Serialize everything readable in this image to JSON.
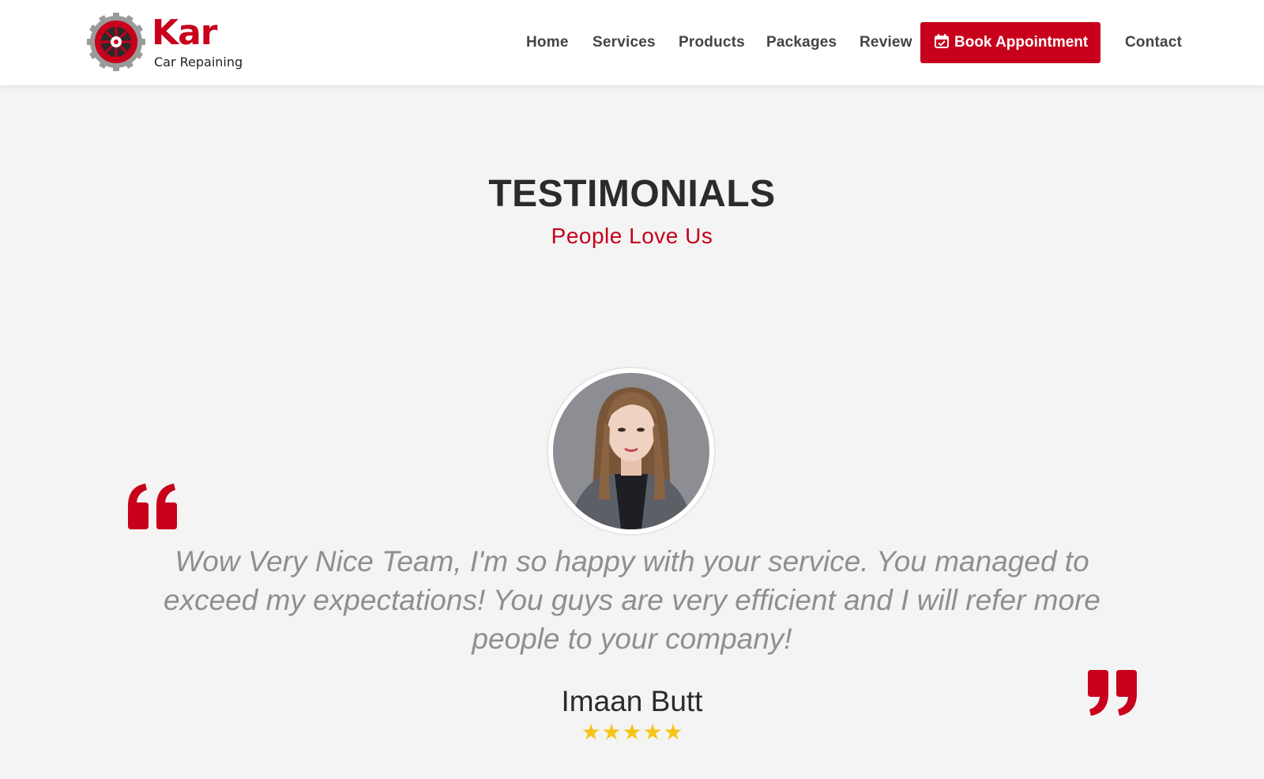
{
  "brand": {
    "name": "Kar",
    "tagline": "Car Repaining",
    "accent": "#c8001c"
  },
  "nav": {
    "items": [
      {
        "label": "Home"
      },
      {
        "label": "Services"
      },
      {
        "label": "Products"
      },
      {
        "label": "Packages"
      },
      {
        "label": "Review"
      }
    ],
    "book_label": "Book Appointment",
    "book_icon": "calendar-check-icon",
    "contact_label": "Contact"
  },
  "testimonials": {
    "title": "TESTIMONIALS",
    "subtitle": "People Love Us",
    "quote": "Wow Very Nice Team, I'm so happy with your service. You managed to exceed my expectations! You guys are very efficient and I will refer more people to your company!",
    "author": "Imaan Butt",
    "rating": 5,
    "rating_max": 5,
    "star_color": "#f5c518",
    "quote_icons": [
      "quote-open-icon",
      "quote-close-icon"
    ]
  }
}
